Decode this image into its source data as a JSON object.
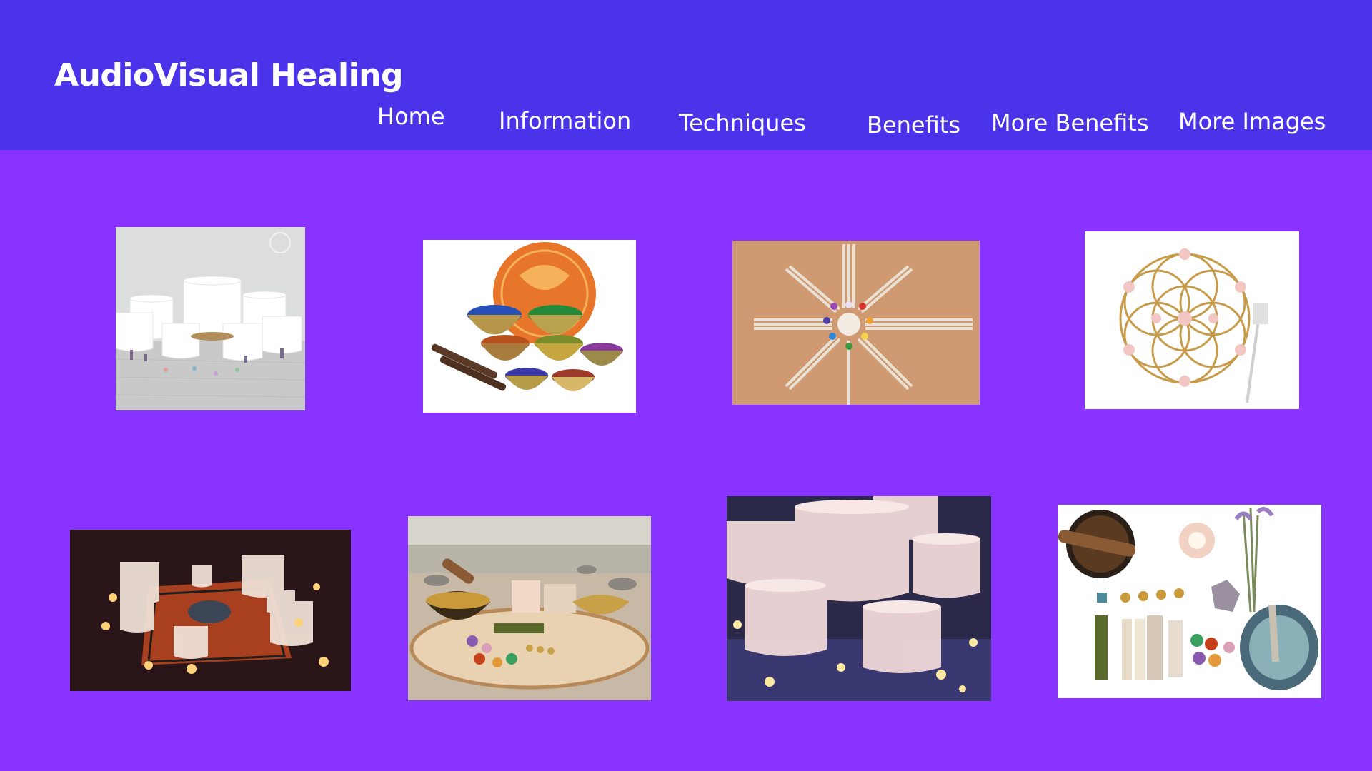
{
  "site": {
    "title": "AudioVisual Healing"
  },
  "nav": {
    "items": [
      {
        "label": "Home"
      },
      {
        "label": "Information"
      },
      {
        "label": "Techniques"
      },
      {
        "label": "Benefits"
      },
      {
        "label": "More Benefits"
      },
      {
        "label": "More Images"
      }
    ]
  },
  "gallery": {
    "photos": [
      {
        "subject": "white-crystal-singing-bowls"
      },
      {
        "subject": "tibetan-singing-bowls-with-case"
      },
      {
        "subject": "tuning-forks-star-arrangement"
      },
      {
        "subject": "flower-of-life-crystal-grid"
      },
      {
        "subject": "candlelit-crystal-bowl-circle"
      },
      {
        "subject": "beach-wood-slab-healing-kit"
      },
      {
        "subject": "glowing-frosted-crystal-bowls"
      },
      {
        "subject": "flatlay-singing-bowl-sage-crystals"
      }
    ]
  },
  "colors": {
    "header_bg": "#4a33e8",
    "page_bg": "#8833ff",
    "text": "#ffffff"
  }
}
